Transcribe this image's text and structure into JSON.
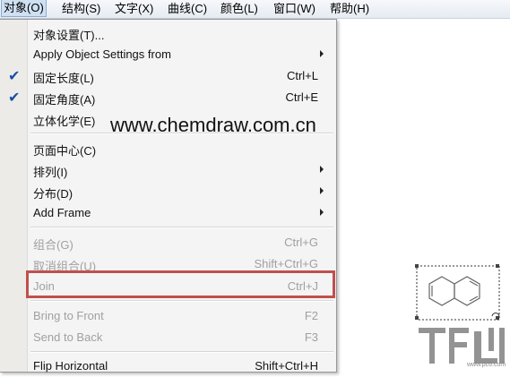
{
  "menubar": [
    {
      "label": "对象(O)"
    },
    {
      "label": "结构(S)"
    },
    {
      "label": "文字(X)"
    },
    {
      "label": "曲线(C)"
    },
    {
      "label": "颜色(L)"
    },
    {
      "label": "窗口(W)"
    },
    {
      "label": "帮助(H)"
    }
  ],
  "menu": {
    "items": [
      {
        "label": "对象设置(T)...",
        "shortcut": "",
        "checked": false,
        "submenu": false,
        "enabled": true
      },
      {
        "label": "Apply Object Settings from",
        "shortcut": "",
        "checked": false,
        "submenu": true,
        "enabled": true
      },
      {
        "label": "固定长度(L)",
        "shortcut": "Ctrl+L",
        "checked": true,
        "submenu": false,
        "enabled": true
      },
      {
        "label": "固定角度(A)",
        "shortcut": "Ctrl+E",
        "checked": true,
        "submenu": false,
        "enabled": true
      },
      {
        "label": "立体化学(E)",
        "shortcut": "",
        "checked": false,
        "submenu": false,
        "enabled": true
      },
      {
        "label": "页面中心(C)",
        "shortcut": "",
        "checked": false,
        "submenu": false,
        "enabled": true
      },
      {
        "label": "排列(I)",
        "shortcut": "",
        "checked": false,
        "submenu": true,
        "enabled": true
      },
      {
        "label": "分布(D)",
        "shortcut": "",
        "checked": false,
        "submenu": true,
        "enabled": true
      },
      {
        "label": "Add Frame",
        "shortcut": "",
        "checked": false,
        "submenu": true,
        "enabled": true
      },
      {
        "label": "组合(G)",
        "shortcut": "Ctrl+G",
        "checked": false,
        "submenu": false,
        "enabled": false
      },
      {
        "label": "取消组合(U)",
        "shortcut": "Shift+Ctrl+G",
        "checked": false,
        "submenu": false,
        "enabled": false
      },
      {
        "label": "Join",
        "shortcut": "Ctrl+J",
        "checked": false,
        "submenu": false,
        "enabled": false
      },
      {
        "label": "Bring to Front",
        "shortcut": "F2",
        "checked": false,
        "submenu": false,
        "enabled": false
      },
      {
        "label": "Send to Back",
        "shortcut": "F3",
        "checked": false,
        "submenu": false,
        "enabled": false
      },
      {
        "label": "Flip Horizontal",
        "shortcut": "Shift+Ctrl+H",
        "checked": false,
        "submenu": false,
        "enabled": true
      }
    ]
  },
  "watermark": "www.chemdraw.com.cn",
  "colors": {
    "highlight_box": "#c0504d",
    "check": "#1a4fa3",
    "accent_menu": "#cfe0f3"
  }
}
